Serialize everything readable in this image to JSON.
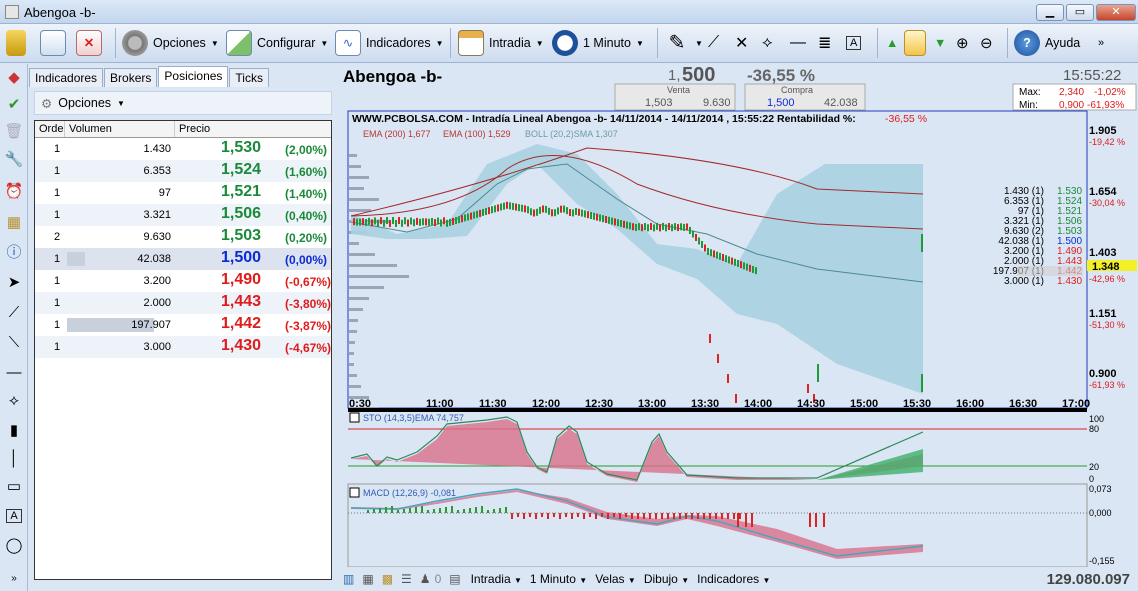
{
  "window": {
    "title": "Abengoa -b-"
  },
  "toolbar": {
    "opciones": "Opciones",
    "configurar": "Configurar",
    "indicadores": "Indicadores",
    "intradia": "Intradia",
    "interval": "1 Minuto",
    "ayuda": "Ayuda"
  },
  "tabs": [
    "Indicadores",
    "Brokers",
    "Posiciones",
    "Ticks"
  ],
  "panel": {
    "options_label": "Opciones",
    "col_orders": "Orde",
    "col_volume": "Volumen",
    "col_price": "Precio"
  },
  "positions": [
    {
      "orders": "1",
      "volume": "1.430",
      "price": "1,530",
      "change": "(2,00%)",
      "color": "#1a8a3a",
      "bar": 0
    },
    {
      "orders": "1",
      "volume": "6.353",
      "price": "1,524",
      "change": "(1,60%)",
      "color": "#1a8a3a",
      "bar": 0
    },
    {
      "orders": "1",
      "volume": "97",
      "price": "1,521",
      "change": "(1,40%)",
      "color": "#1a8a3a",
      "bar": 0
    },
    {
      "orders": "1",
      "volume": "3.321",
      "price": "1,506",
      "change": "(0,40%)",
      "color": "#1a8a3a",
      "bar": 0
    },
    {
      "orders": "2",
      "volume": "9.630",
      "price": "1,503",
      "change": "(0,20%)",
      "color": "#1a8a3a",
      "bar": 0
    },
    {
      "orders": "1",
      "volume": "42.038",
      "price": "1,500",
      "change": "(0,00%)",
      "color": "#0b2bd6",
      "bar": 0.13
    },
    {
      "orders": "1",
      "volume": "3.200",
      "price": "1,490",
      "change": "(-0,67%)",
      "color": "#e01b1b",
      "bar": 0
    },
    {
      "orders": "1",
      "volume": "2.000",
      "price": "1,443",
      "change": "(-3,80%)",
      "color": "#e01b1b",
      "bar": 0
    },
    {
      "orders": "1",
      "volume": "197.907",
      "price": "1,442",
      "change": "(-3,87%)",
      "color": "#e01b1b",
      "bar": 0.62
    },
    {
      "orders": "1",
      "volume": "3.000",
      "price": "1,430",
      "change": "(-4,67%)",
      "color": "#e01b1b",
      "bar": 0
    }
  ],
  "header": {
    "ticker": "Abengoa -b-",
    "last_int": "1,",
    "last_dec": "500",
    "change_pct": "-36,55 %",
    "time": "15:55:22",
    "venta_label": "Venta",
    "venta_price": "1,503",
    "venta_vol": "9.630",
    "compra_label": "Compra",
    "compra_price": "1,500",
    "compra_vol": "42.038",
    "max_label": "Max:",
    "max_val": "2,340",
    "max_pct": "-1,02%",
    "min_label": "Min:",
    "min_val": "0,900",
    "min_pct": "-61,93%"
  },
  "chart": {
    "title": "WWW.PCBOLSA.COM - Intradía Lineal Abengoa -b- 14/11/2014 - 14/11/2014 , 15:55:22 Rentabilidad %:",
    "title_pct": "-36,55 %",
    "legend_ema200": "EMA (200) 1,677",
    "legend_ema100": "EMA (100) 1,529",
    "legend_boll": "BOLL (20,2)SMA 1,307",
    "price_ticks": [
      {
        "v": "1.905",
        "p": "-19,42 %"
      },
      {
        "v": "1.654",
        "p": "-30,04 %"
      },
      {
        "v": "1.403",
        "p": ""
      },
      {
        "v": "1.151",
        "p": "-51,30 %"
      },
      {
        "v": "0.900",
        "p": "-61,93 %"
      }
    ],
    "current_price": "1.348",
    "current_pct": "-42,96 %",
    "time_labels": [
      "0:30",
      "11:00",
      "11:30",
      "12:00",
      "12:30",
      "13:00",
      "13:30",
      "14:00",
      "14:30",
      "15:00",
      "15:30",
      "16:00",
      "16:30",
      "17:00"
    ],
    "book": [
      {
        "vol": "1.430 (1)",
        "p": "1.530",
        "c": "#1a8a3a"
      },
      {
        "vol": "6.353 (1)",
        "p": "1.524",
        "c": "#1a8a3a"
      },
      {
        "vol": "97 (1)",
        "p": "1.521",
        "c": "#1a8a3a"
      },
      {
        "vol": "3.321 (1)",
        "p": "1.506",
        "c": "#1a8a3a"
      },
      {
        "vol": "9.630 (2)",
        "p": "1.503",
        "c": "#1a8a3a"
      },
      {
        "vol": "42.038 (1)",
        "p": "1.500",
        "c": "#0b2bd6"
      },
      {
        "vol": "3.200 (1)",
        "p": "1.490",
        "c": "#e01b1b"
      },
      {
        "vol": "2.000 (1)",
        "p": "1.443",
        "c": "#e01b1b"
      },
      {
        "vol": "197.907 (1)",
        "p": "1.442",
        "c": "#e01b1b"
      },
      {
        "vol": "3.000 (1)",
        "p": "1.430",
        "c": "#e01b1b"
      }
    ],
    "sto_label": "STO (14,3,5)EMA 74,757",
    "sto_ticks": [
      "100",
      "80",
      "20",
      "0"
    ],
    "macd_label": "MACD (12,26,9) -0,081",
    "macd_ticks": [
      "0,073",
      "0,000",
      "-0,155"
    ]
  },
  "status": {
    "zero": "0",
    "intradia": "Intradia",
    "interval": "1 Minuto",
    "velas": "Velas",
    "dibujo": "Dibujo",
    "indicadores": "Indicadores",
    "volume": "129.080.097"
  },
  "colors": {
    "green": "#1a8a3a",
    "red": "#e01b1b",
    "blue": "#0b2bd6",
    "band": "#a9d2e2"
  }
}
